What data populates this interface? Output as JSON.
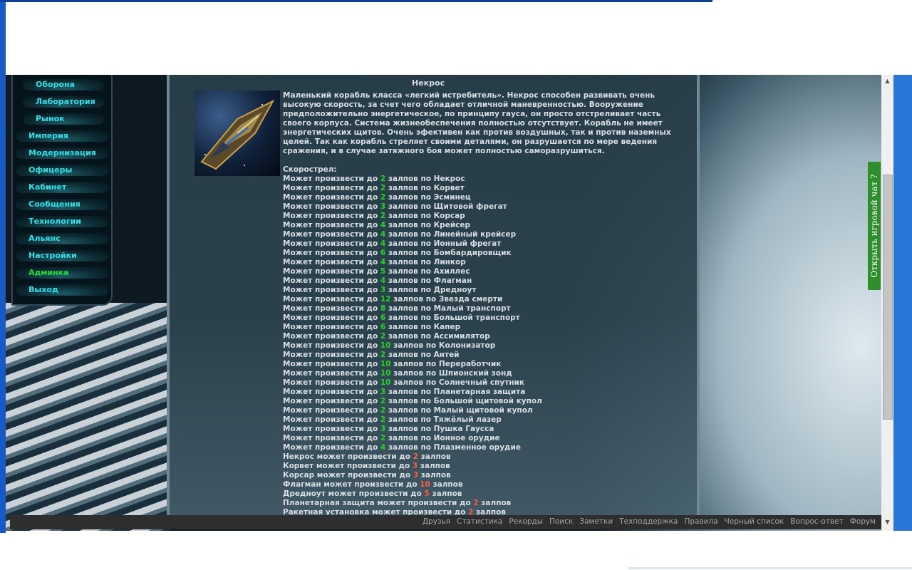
{
  "menu": {
    "items": [
      {
        "label": "Оборона",
        "sub": true
      },
      {
        "label": "Лаборатория",
        "sub": true
      },
      {
        "label": "Рынок",
        "sub": true
      },
      {
        "label": "Империя"
      },
      {
        "label": "Модернизация"
      },
      {
        "label": "Офицеры"
      },
      {
        "label": "Кабинет"
      },
      {
        "label": "Сообщения"
      },
      {
        "label": "Технологии"
      },
      {
        "label": "Альянс"
      },
      {
        "label": "Настройки"
      },
      {
        "label": "Админка",
        "accent": "#1edc3a"
      },
      {
        "label": "Выход"
      }
    ]
  },
  "ship": {
    "name": "Некрос",
    "description": "Маленький корабль класса «легкий истребитель». Некрос способен развивать очень высокую скорость, за счет чего обладает отличной маневренностью. Вооружение предположительно энергетическое, по принципу гауса, он просто отстреливает часть своего корпуса. Система жизнеобеспечения полностью отсутствует. Корабль не имеет энергетических щитов. Очень эфективен как против воздушных, так и против наземных целей. Так как корабль стреляет своими деталями, он разрушается по мере ведения сражения, и в случае затяжного боя может полностью саморазрушиться.",
    "rapidfire_label": "Скорострел:"
  },
  "rapidfire_against": [
    {
      "pre": "Может произвести до ",
      "num": "2",
      "post": " залпов по Некрос"
    },
    {
      "pre": "Может произвести до ",
      "num": "2",
      "post": " залпов по Корвет"
    },
    {
      "pre": "Может произвести до ",
      "num": "2",
      "post": " залпов по Эсминец"
    },
    {
      "pre": "Может произвести до ",
      "num": "3",
      "post": " залпов по Щитовой фрегат"
    },
    {
      "pre": "Может произвести до ",
      "num": "2",
      "post": " залпов по Корсар"
    },
    {
      "pre": "Может произвести до ",
      "num": "4",
      "post": " залпов по Крейсер"
    },
    {
      "pre": "Может произвести до ",
      "num": "4",
      "post": " залпов по Линейный крейсер"
    },
    {
      "pre": "Может произвести до ",
      "num": "4",
      "post": " залпов по Ионный фрегат"
    },
    {
      "pre": "Может произвести до ",
      "num": "6",
      "post": " залпов по Бомбардировщик"
    },
    {
      "pre": "Может произвести до ",
      "num": "4",
      "post": " залпов по Линкор"
    },
    {
      "pre": "Может произвести до ",
      "num": "5",
      "post": " залпов по Ахиллес"
    },
    {
      "pre": "Может произвести до ",
      "num": "4",
      "post": " залпов по Флагман"
    },
    {
      "pre": "Может произвести до ",
      "num": "3",
      "post": " залпов по Дредноут"
    },
    {
      "pre": "Может произвести до ",
      "num": "12",
      "post": " залпов по Звезда смерти"
    },
    {
      "pre": "Может произвести до ",
      "num": "8",
      "post": " залпов по Малый транспорт"
    },
    {
      "pre": "Может произвести до ",
      "num": "6",
      "post": " залпов по Большой транспорт"
    },
    {
      "pre": "Может произвести до ",
      "num": "6",
      "post": " залпов по Капер"
    },
    {
      "pre": "Может произвести до ",
      "num": "2",
      "post": " залпов по Ассимилятор"
    },
    {
      "pre": "Может произвести до ",
      "num": "10",
      "post": " залпов по Колонизатор"
    },
    {
      "pre": "Может произвести до ",
      "num": "2",
      "post": " залпов по Антей"
    },
    {
      "pre": "Может произвести до ",
      "num": "10",
      "post": " залпов по Переработчик"
    },
    {
      "pre": "Может произвести до ",
      "num": "10",
      "post": " залпов по Шпионский зонд"
    },
    {
      "pre": "Может произвести до ",
      "num": "10",
      "post": " залпов по Солнечный спутник"
    },
    {
      "pre": "Может произвести до ",
      "num": "3",
      "post": " залпов по Планетарная защита"
    },
    {
      "pre": "Может произвести до ",
      "num": "2",
      "post": " залпов по Большой щитовой купол"
    },
    {
      "pre": "Может произвести до ",
      "num": "2",
      "post": " залпов по Малый щитовой купол"
    },
    {
      "pre": "Может произвести до ",
      "num": "2",
      "post": " залпов по Тяжёлый лазер"
    },
    {
      "pre": "Может произвести до ",
      "num": "3",
      "post": " залпов по Пушка Гаусса"
    },
    {
      "pre": "Может произвести до ",
      "num": "2",
      "post": " залпов по Ионное орудие"
    },
    {
      "pre": "Может произвести до ",
      "num": "4",
      "post": " залпов по Плазменное орудие"
    }
  ],
  "rapidfire_from": [
    {
      "pre": "Некрос может произвести до ",
      "num": "2",
      "post": " залпов"
    },
    {
      "pre": "Корвет может произвести до ",
      "num": "3",
      "post": " залпов"
    },
    {
      "pre": "Корсар может произвести до ",
      "num": "3",
      "post": " залпов"
    },
    {
      "pre": "Флагман может произвести до ",
      "num": "10",
      "post": " залпов"
    },
    {
      "pre": "Дредноут может произвести до ",
      "num": "5",
      "post": " залпов"
    },
    {
      "pre": "Планетарная защита может произвести до ",
      "num": "2",
      "post": " залпов"
    },
    {
      "pre": "Ракетная установка может произвести до ",
      "num": "2",
      "post": " залпов"
    }
  ],
  "footer": {
    "links": [
      "Друзья",
      "Статистика",
      "Рекорды",
      "Поиск",
      "Заметки",
      "Техподдержка",
      "Правила",
      "Черный список",
      "Вопрос-ответ",
      "Форум"
    ]
  },
  "chat_tab": {
    "label": "Открыть игровой чат ?"
  },
  "scrollbar": {
    "up_icon": "▲",
    "down_icon": "▼"
  },
  "colors": {
    "menu_text": "#2de0e6",
    "number_green": "#21d521",
    "number_red": "#ff5a3a",
    "chat_tab": "#2c8f2c"
  }
}
